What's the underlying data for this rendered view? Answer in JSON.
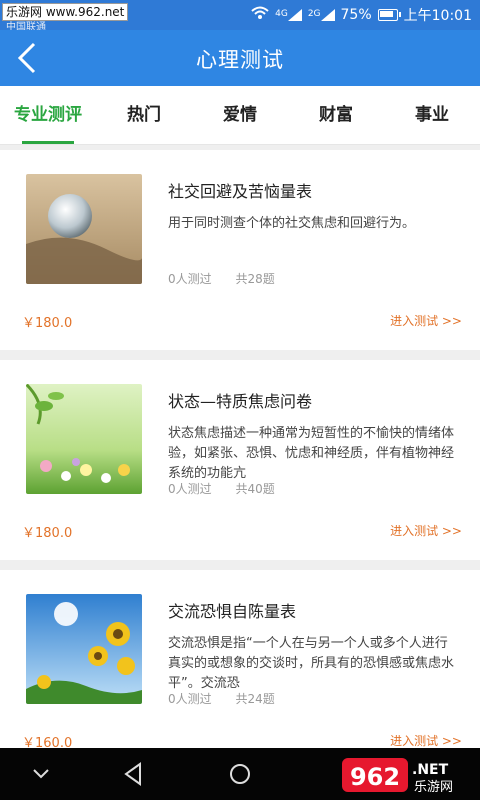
{
  "status_bar": {
    "watermark": "乐游网 www.962.net",
    "carrier": "中国联通",
    "net1": "4G",
    "net2": "2G",
    "battery": "75%",
    "time": "上午10:01"
  },
  "header": {
    "title": "心理测试",
    "back_icon": "chevron-left-icon"
  },
  "tabs": [
    {
      "label": "专业测评",
      "active": true
    },
    {
      "label": "热门"
    },
    {
      "label": "爱情"
    },
    {
      "label": "财富"
    },
    {
      "label": "事业"
    }
  ],
  "tests": [
    {
      "title": "社交回避及苦恼量表",
      "desc": "用于同时测查个体的社交焦虑和回避行为。",
      "count": "0人测过",
      "questions": "共28题",
      "price": "￥180.0",
      "enter": "进入测试 >>",
      "image": "crystal-ball-on-sand"
    },
    {
      "title": "状态—特质焦虑问卷",
      "desc": "状态焦虑描述一种通常为短暂性的不愉快的情绪体验，如紧张、恐惧、忧虑和神经质，伴有植物神经系统的功能亢",
      "count": "0人测过",
      "questions": "共40题",
      "price": "￥180.0",
      "enter": "进入测试 >>",
      "image": "flowers-in-green-field"
    },
    {
      "title": "交流恐惧自陈量表",
      "desc": "交流恐惧是指“一个人在与另一个人或多个人进行真实的或想象的交谈时，所具有的恐惧感或焦虑水平”。交流恐",
      "count": "0人测过",
      "questions": "共24题",
      "price": "￥160.0",
      "enter": "进入测试 >>",
      "image": "sunflowers-blue-sky"
    }
  ],
  "watermark_logo": {
    "brand": "962",
    "suffix": ".NET",
    "subtitle": "乐游网"
  },
  "colors": {
    "appbar": "#2f86e3",
    "active_tab": "#2aa640",
    "price": "#e2732a"
  }
}
